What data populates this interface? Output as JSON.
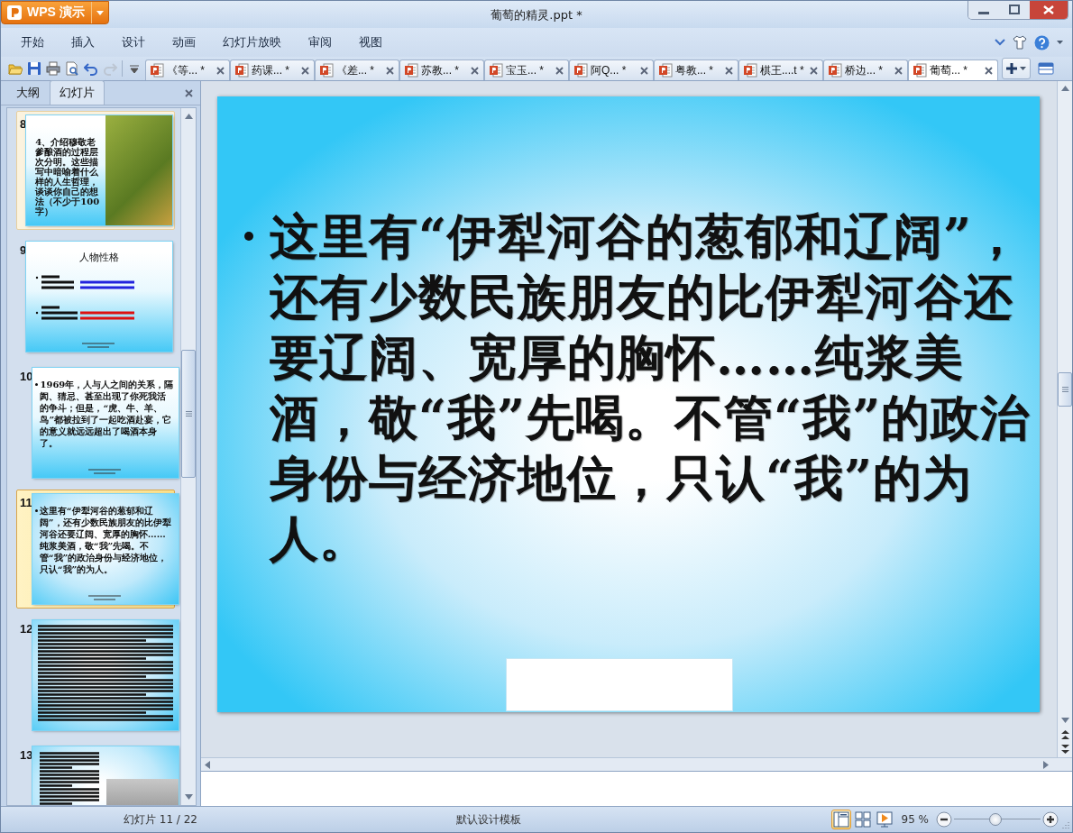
{
  "app_button": {
    "label": "WPS 演示"
  },
  "window": {
    "title": "葡萄的精灵.ppt *"
  },
  "menu": [
    {
      "label": "开始"
    },
    {
      "label": "插入"
    },
    {
      "label": "设计"
    },
    {
      "label": "动画"
    },
    {
      "label": "幻灯片放映"
    },
    {
      "label": "审阅"
    },
    {
      "label": "视图"
    }
  ],
  "toolbar": [
    {
      "kind": "open",
      "disabled": false
    },
    {
      "kind": "save",
      "disabled": false
    },
    {
      "kind": "print",
      "disabled": false
    },
    {
      "kind": "preview",
      "disabled": false
    },
    {
      "kind": "undo",
      "disabled": false
    },
    {
      "kind": "redo",
      "disabled": true
    },
    {
      "kind": "more",
      "disabled": false
    }
  ],
  "document_tabs": [
    {
      "label": "《等... *",
      "selected": false
    },
    {
      "label": "药课... *",
      "selected": false
    },
    {
      "label": "《差... *",
      "selected": false
    },
    {
      "label": "苏教... *",
      "selected": false
    },
    {
      "label": "宝玉... *",
      "selected": false
    },
    {
      "label": "阿Q... *",
      "selected": false
    },
    {
      "label": "粤教... *",
      "selected": false
    },
    {
      "label": "棋王....t *",
      "selected": false
    },
    {
      "label": "桥边... *",
      "selected": false
    },
    {
      "label": "葡萄... *",
      "selected": true
    }
  ],
  "sidebar": {
    "tabs": [
      {
        "label": "大纲",
        "selected": false
      },
      {
        "label": "幻灯片",
        "selected": true
      }
    ],
    "slides": [
      {
        "number": "8",
        "kind": "text-photo",
        "selected": false,
        "hover": true,
        "text": "4、介绍穆敬老爹酿酒的过程层次分明。这些描写中暗喻着什么样的人生哲理，谈谈你自己的想法（不少于100字）"
      },
      {
        "number": "9",
        "kind": "outline",
        "selected": false,
        "hover": false,
        "title": "人物性格"
      },
      {
        "number": "10",
        "kind": "bullet",
        "selected": false,
        "hover": false,
        "text": "1969年，人与人之间的关系，隔阂、猜忌、甚至出现了你死我活的争斗；但是，“虎、牛、羊、鸟”都被拉到了一起吃酒赴宴，它的意义就远远超出了喝酒本身了。"
      },
      {
        "number": "11",
        "kind": "bullet",
        "selected": true,
        "hover": false,
        "text": "这里有“伊犁河谷的葱郁和辽阔”，还有少数民族朋友的比伊犁河谷还要辽阔、宽厚的胸怀……纯浆美酒，敬“我”先喝。不管“我”的政治身份与经济地位，只认“我”的为人。"
      },
      {
        "number": "12",
        "kind": "dense",
        "selected": false,
        "hover": false
      },
      {
        "number": "13",
        "kind": "photo-dense",
        "selected": false,
        "hover": false
      }
    ]
  },
  "slide": {
    "bullets": [
      "这里有“伊犁河谷的葱郁和辽阔”，还有少数民族朋友的比伊犁河谷还要辽阔、宽厚的胸怀……纯浆美酒，敬“我”先喝。不管“我”的政治身份与经济地位，只认“我”的为人。"
    ]
  },
  "status_bar": {
    "slide_counter": "幻灯片 11 / 22",
    "template": "默认设计模板",
    "views": [
      {
        "kind": "normal",
        "selected": true
      },
      {
        "kind": "sorter",
        "selected": false
      },
      {
        "kind": "show",
        "selected": false
      }
    ],
    "zoom": "95 %",
    "zoom_slider": {
      "level": 0.47
    }
  }
}
